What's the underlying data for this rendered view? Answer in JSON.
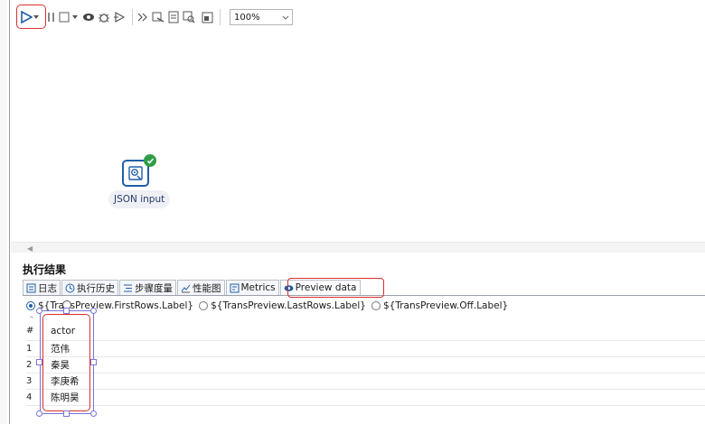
{
  "toolbar": {
    "zoom_value": "100%",
    "icons": [
      "run-icon",
      "run-options-icon",
      "pause-icon",
      "stop-icon",
      "stop-options-icon",
      "preview-icon",
      "debug-icon",
      "replay-icon",
      "verify-icon",
      "analyze-impact-icon",
      "sql-icon",
      "explore-db-icon",
      "show-results-icon"
    ]
  },
  "canvas": {
    "step_label": "JSON input"
  },
  "results": {
    "title": "执行结果",
    "tabs": [
      {
        "label": "日志"
      },
      {
        "label": "执行历史"
      },
      {
        "label": "步骤度量"
      },
      {
        "label": "性能图"
      },
      {
        "label": "Metrics"
      },
      {
        "label": "Preview data"
      }
    ],
    "radios": [
      {
        "label": "${TransPreview.FirstRows.Label}",
        "checked": true
      },
      {
        "label": "${TransPreview.LastRows.Label}",
        "checked": false
      },
      {
        "label": "${TransPreview.Off.Label}",
        "checked": false
      }
    ],
    "table": {
      "num_header": "#",
      "column_header": "actor",
      "rows": [
        {
          "num": "1",
          "actor": "范伟"
        },
        {
          "num": "2",
          "actor": "秦昊"
        },
        {
          "num": "3",
          "actor": "李庚希"
        },
        {
          "num": "4",
          "actor": "陈明昊"
        }
      ]
    }
  },
  "colors": {
    "highlight_red": "#d93030",
    "accent_blue": "#1f5fa6",
    "success_green": "#2e9e48",
    "selection_purple": "#7a74d8"
  }
}
